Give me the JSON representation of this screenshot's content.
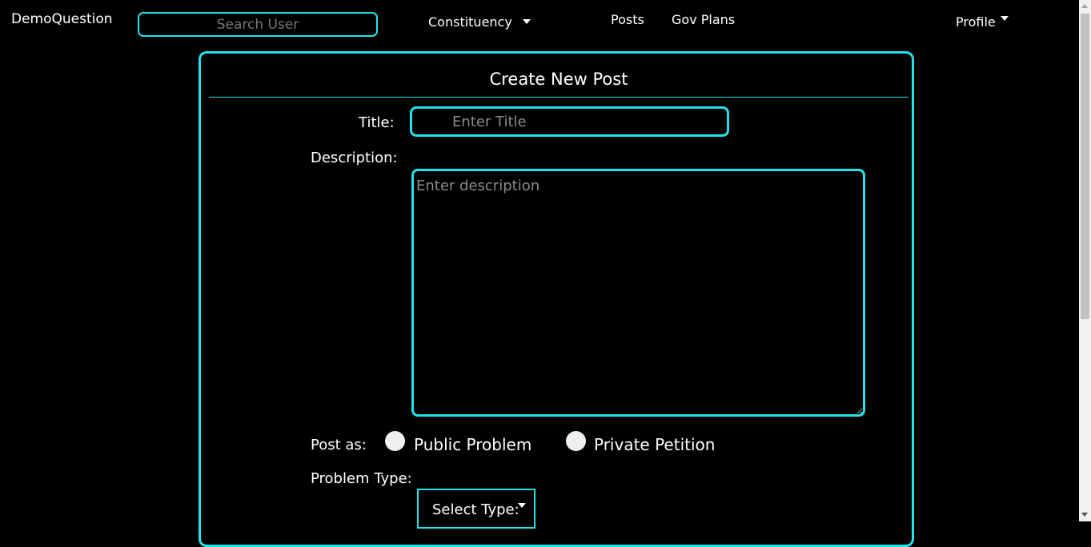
{
  "nav": {
    "brand": "DemoQuestion",
    "search_placeholder": "Search User",
    "constituency_label": "Constituency",
    "posts_label": "Posts",
    "gov_plans_label": "Gov Plans",
    "profile_label": "Profile"
  },
  "form": {
    "heading": "Create New Post",
    "title_label": "Title:",
    "title_placeholder": "Enter Title",
    "description_label": "Description:",
    "description_placeholder": "Enter description",
    "post_as_label": "Post as:",
    "post_as_options": [
      {
        "label": "Public Problem",
        "selected": false
      },
      {
        "label": "Private Petition",
        "selected": false
      }
    ],
    "problem_type_label": "Problem Type:",
    "problem_type_select": "Select Type:"
  },
  "colors": {
    "accent": "#22e3ea",
    "background": "#000000",
    "text": "#ffffff"
  }
}
